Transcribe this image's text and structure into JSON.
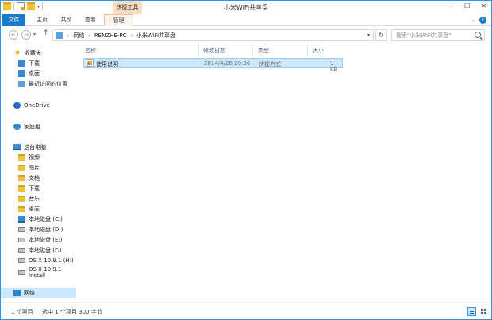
{
  "window": {
    "title": "小米WiFi共享盘",
    "context_tab_title": "快捷工具",
    "controls": [
      "—",
      "☐",
      "✕"
    ]
  },
  "ribbon": {
    "tabs": {
      "file": "文件",
      "home": "主页",
      "share": "共享",
      "view": "查看",
      "manage": "管理"
    },
    "help": "?"
  },
  "address_bar": {
    "crumbs": [
      "网络",
      "RENZHE-PC",
      "小米WiFi共享盘"
    ],
    "search_placeholder": "搜索\"小米WiFi共享盘\""
  },
  "nav_pane": {
    "favorites": {
      "label": "收藏夹",
      "items": [
        "下载",
        "桌面",
        "最近访问的位置"
      ]
    },
    "onedrive": "OneDrive",
    "homegroup": "家庭组",
    "this_pc": {
      "label": "这台电脑",
      "items": [
        "视频",
        "图片",
        "文档",
        "下载",
        "音乐",
        "桌面",
        "本地磁盘 (C:)",
        "本地磁盘 (D:)",
        "本地磁盘 (E:)",
        "本地磁盘 (F:)",
        "OS X 10.9.1 (H:)",
        "OS X 10.9.1 Install"
      ]
    },
    "network": "网络"
  },
  "file_list": {
    "columns": {
      "name": "名称",
      "date": "修改日期",
      "type": "类型",
      "size": "大小"
    },
    "rows": [
      {
        "name": "使用说明",
        "date": "2014/4/26 20:36",
        "type": "快捷方式",
        "size": "1 KB"
      }
    ]
  },
  "status_bar": {
    "item_count": "1 个项目",
    "selection": "选中 1 个项目  300 字节"
  },
  "colors": {
    "accent": "#1979ca",
    "selection": "#cce8ff",
    "context_tab": "#f9dcc0"
  }
}
